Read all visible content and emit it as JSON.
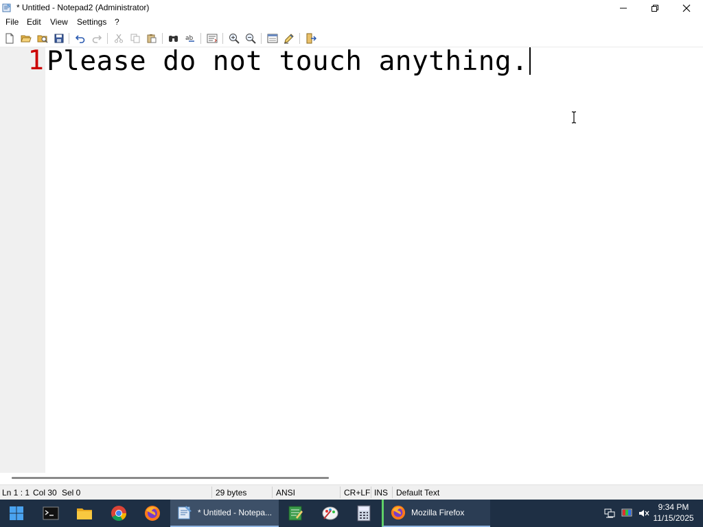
{
  "window": {
    "title": "* Untitled - Notepad2 (Administrator)"
  },
  "menu": {
    "items": [
      "File",
      "Edit",
      "View",
      "Settings",
      "?"
    ]
  },
  "toolbar": {
    "buttons": [
      "new-icon",
      "open-icon",
      "browse-icon",
      "save-icon",
      "undo-icon",
      "redo-icon",
      "cut-icon",
      "copy-icon",
      "paste-icon",
      "find-icon",
      "replace-icon",
      "word-wrap-icon",
      "zoom-in-icon",
      "zoom-out-icon",
      "scheme-icon",
      "customize-icon",
      "exit-icon"
    ]
  },
  "editor": {
    "line_number": "1",
    "text": "Please do not touch anything."
  },
  "statusbar": {
    "position": "Ln 1 : 1",
    "column": "Col 30",
    "selection": "Sel 0",
    "size": "29 bytes",
    "encoding": "ANSI",
    "line_endings": "CR+LF",
    "insert_mode": "INS",
    "scheme": "Default Text"
  },
  "taskbar": {
    "notepad_task": "* Untitled - Notepa...",
    "firefox_task": "Mozilla Firefox",
    "clock_time": "9:34 PM",
    "clock_date": "11/15/2025"
  },
  "colors": {
    "line_number": "#cc0000",
    "taskbar": "#1e2f44",
    "gutter": "#f0f0f0"
  }
}
